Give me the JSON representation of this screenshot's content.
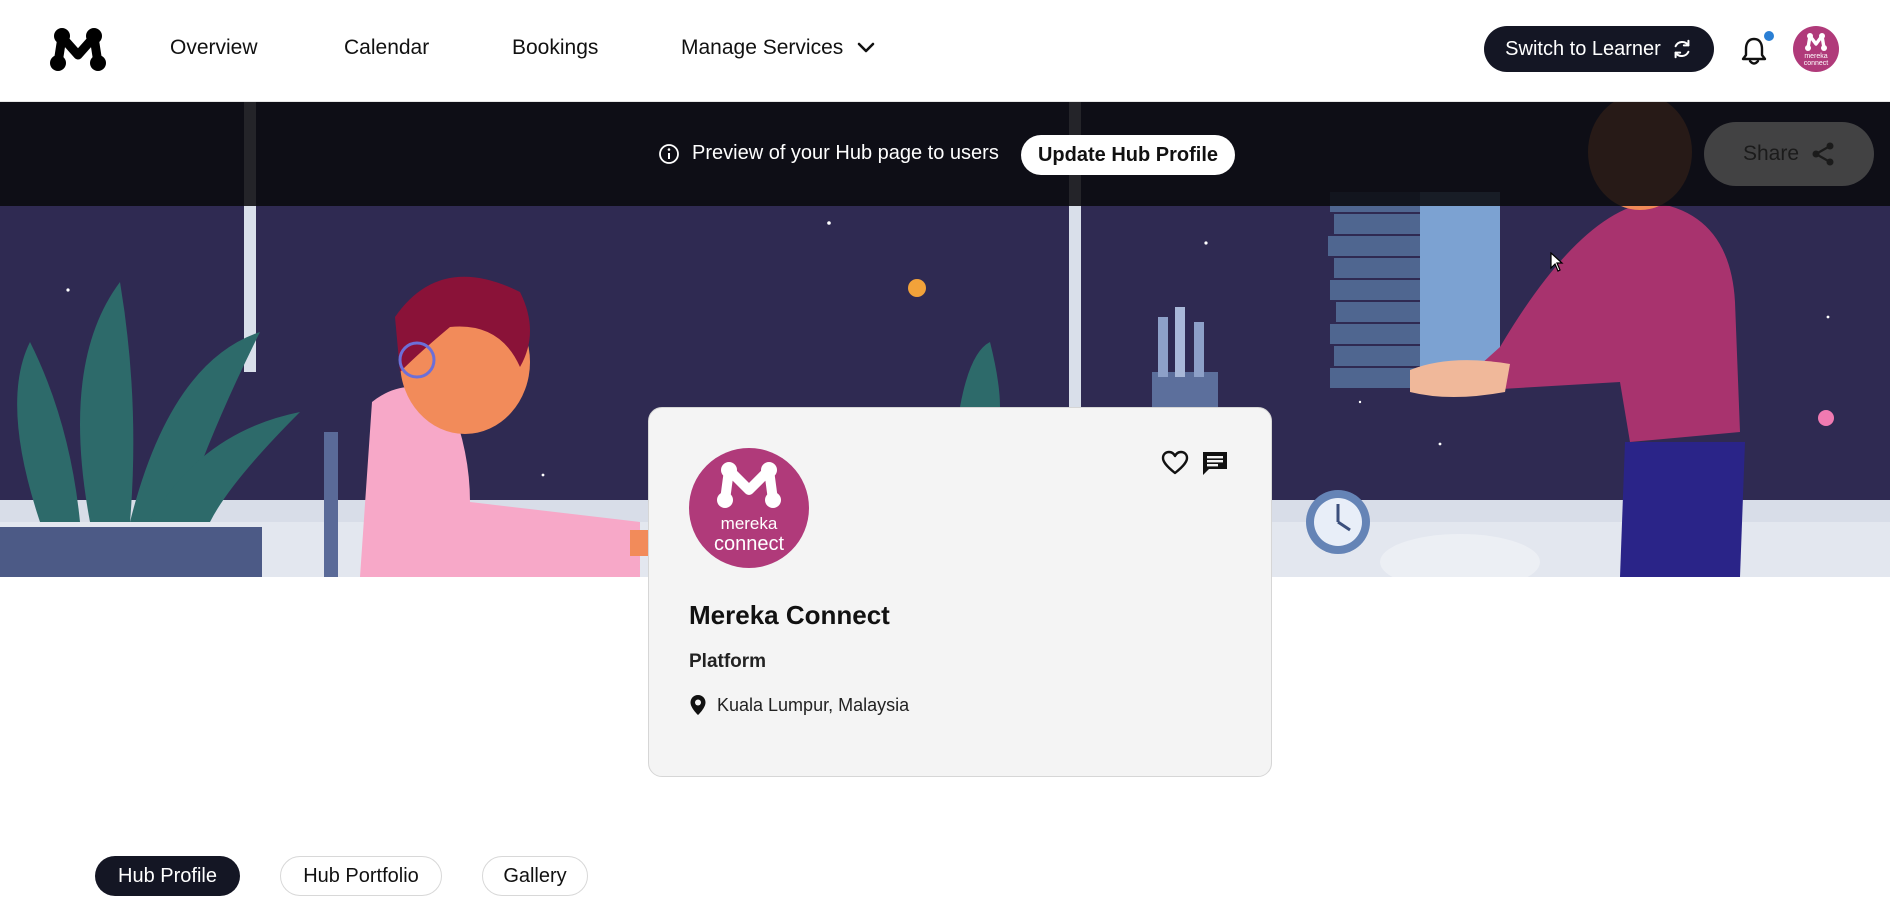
{
  "nav": {
    "items": [
      {
        "label": "Overview"
      },
      {
        "label": "Calendar"
      },
      {
        "label": "Bookings"
      },
      {
        "label": "Manage Services"
      }
    ],
    "switch_label": "Switch to Learner"
  },
  "banner": {
    "preview_text": "Preview of your Hub page to users",
    "update_label": "Update Hub Profile",
    "share_label": "Share"
  },
  "hub": {
    "logo_line1": "mereka",
    "logo_line2": "connect",
    "avatar_line1": "mereka",
    "avatar_line2": "connect",
    "name": "Mereka Connect",
    "type": "Platform",
    "location": "Kuala Lumpur, Malaysia"
  },
  "tabs": [
    {
      "label": "Hub Profile",
      "active": true
    },
    {
      "label": "Hub Portfolio",
      "active": false
    },
    {
      "label": "Gallery",
      "active": false
    }
  ],
  "colors": {
    "brand_dark": "#141624",
    "brand_magenta": "#b03a7a",
    "notification_dot": "#2a7fd4"
  },
  "icons": [
    "mereka-logo-icon",
    "chevron-down-icon",
    "refresh-icon",
    "bell-icon",
    "info-icon",
    "share-icon",
    "heart-icon",
    "chat-icon",
    "location-pin-icon"
  ]
}
